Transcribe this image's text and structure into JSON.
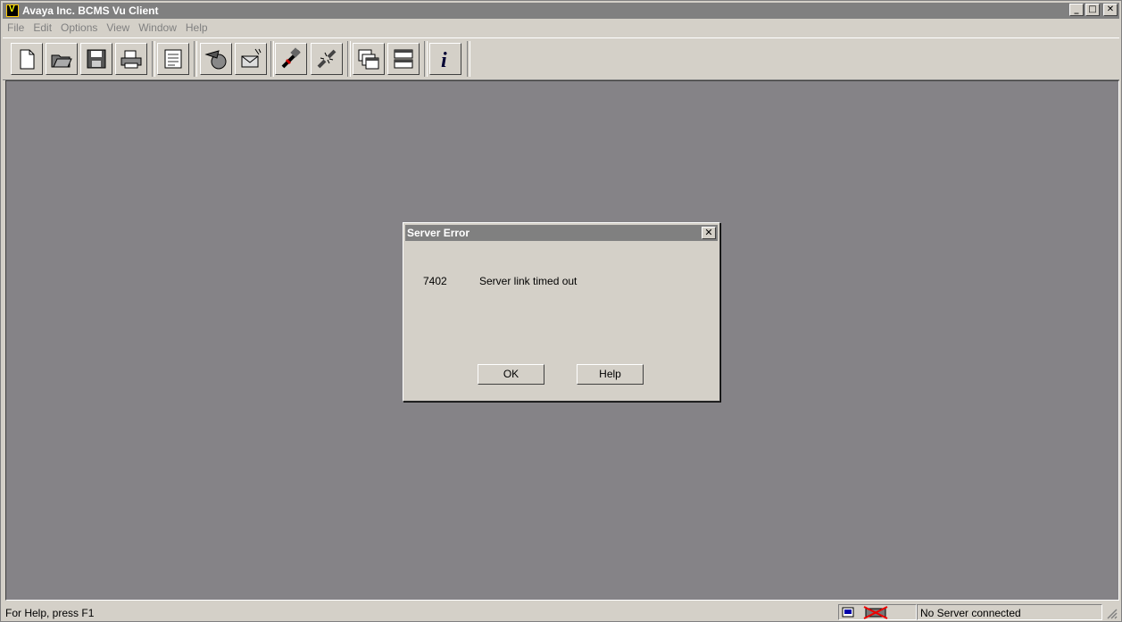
{
  "window": {
    "title": "Avaya Inc. BCMS Vu Client",
    "minimize": "_",
    "maximize": "□",
    "close": "✕"
  },
  "menu": [
    "File",
    "Edit",
    "Options",
    "View",
    "Window",
    "Help"
  ],
  "toolbar": {
    "icons": [
      "new-document-icon",
      "open-folder-icon",
      "save-disk-icon",
      "print-icon",
      "report-icon",
      "connect-dial-icon",
      "message-icon",
      "connect-server-icon",
      "disconnect-server-icon",
      "cascade-windows-icon",
      "tile-windows-icon",
      "info-icon"
    ]
  },
  "dialog": {
    "title": "Server Error",
    "close": "✕",
    "error_code": "7402",
    "error_message": "Server link timed out",
    "ok_label": "OK",
    "help_label": "Help"
  },
  "status": {
    "help_text": "For Help, press F1",
    "server_status": "No Server connected"
  },
  "colors": {
    "client_bg": "#858387",
    "title_bg": "#808080",
    "chrome": "#d4d0c8"
  }
}
